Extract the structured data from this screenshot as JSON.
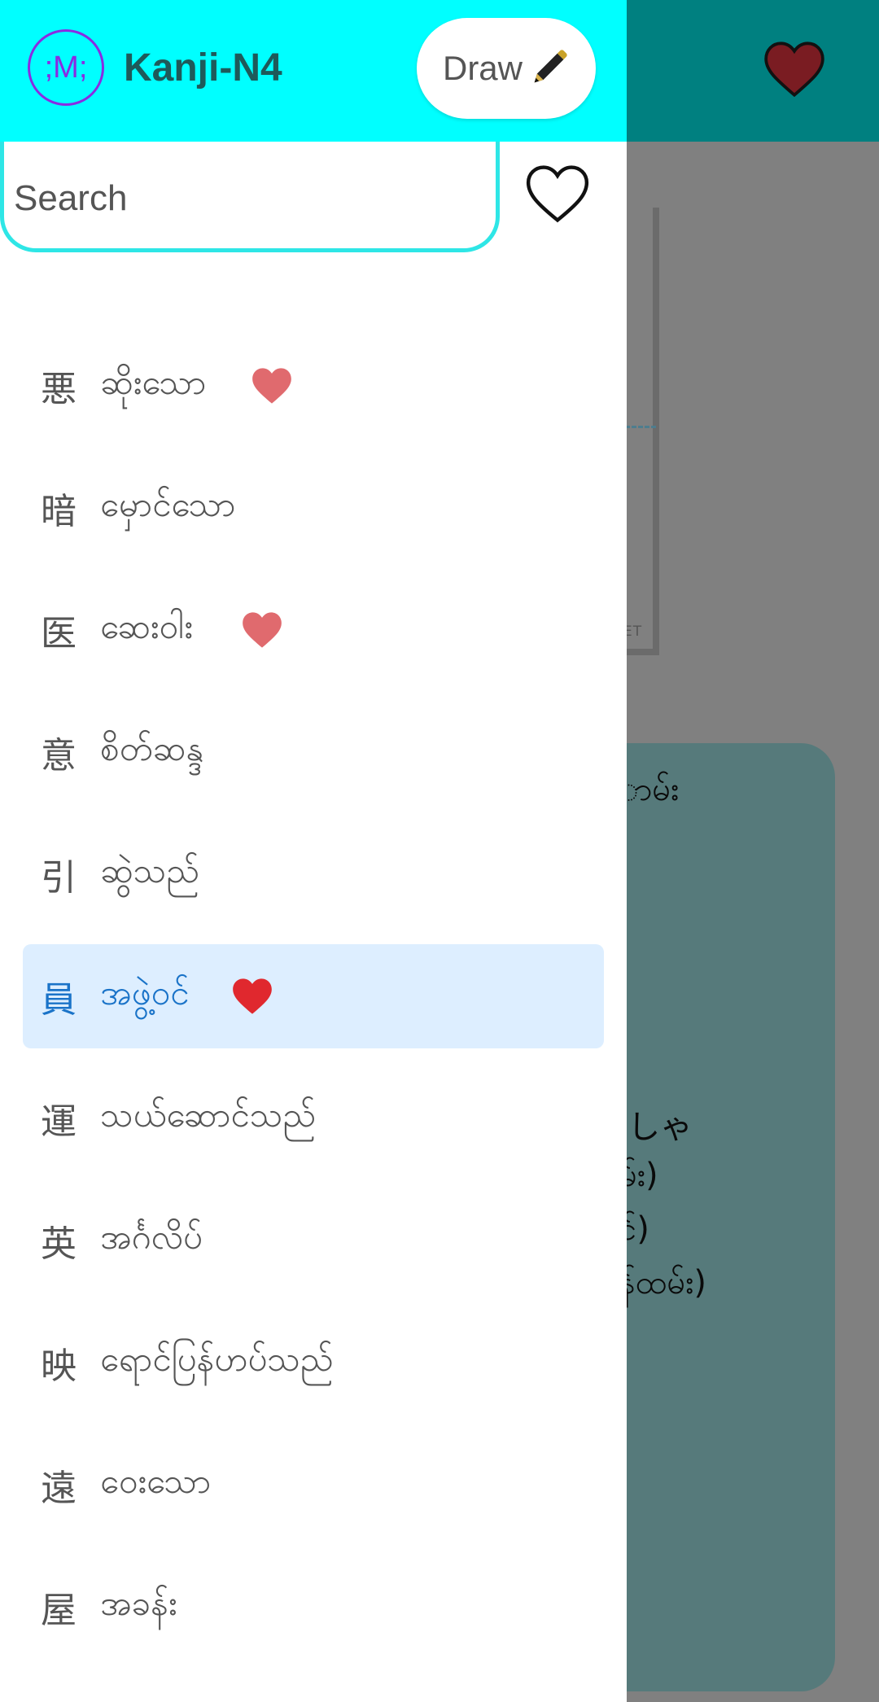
{
  "app": {
    "logo_text": ";M;",
    "title": "Kanji-N4"
  },
  "header": {
    "draw_label": "Draw"
  },
  "search": {
    "placeholder": "Search",
    "value": ""
  },
  "background": {
    "frame_text": "ET",
    "card_lines": [
      "ာမ်း",
      "ıしゃ",
      "မ်း)",
      "င်)",
      "န်ထမ်း)"
    ]
  },
  "colors": {
    "header": "#00ffff",
    "background_appbar": "#008080",
    "selected_row": "#ddeeff",
    "selected_text": "#1a73c8",
    "heart_red": "#e0282e",
    "heart_faded": "#e06a6e"
  },
  "kanji_list": [
    {
      "kanji": "悪",
      "meaning": "ဆိုးသော",
      "favorite": true,
      "selected": false
    },
    {
      "kanji": "暗",
      "meaning": "မှောင်သော",
      "favorite": false,
      "selected": false
    },
    {
      "kanji": "医",
      "meaning": "ဆေးဝါး",
      "favorite": true,
      "selected": false
    },
    {
      "kanji": "意",
      "meaning": "စိတ်ဆန္ဒ",
      "favorite": false,
      "selected": false
    },
    {
      "kanji": "引",
      "meaning": "ဆွဲသည်",
      "favorite": false,
      "selected": false
    },
    {
      "kanji": "員",
      "meaning": "အဖွဲ့ဝင်",
      "favorite": true,
      "selected": true
    },
    {
      "kanji": "運",
      "meaning": "သယ်ဆောင်သည်",
      "favorite": false,
      "selected": false
    },
    {
      "kanji": "英",
      "meaning": "အင်္ဂလိပ်",
      "favorite": false,
      "selected": false
    },
    {
      "kanji": "映",
      "meaning": "ရောင်ပြန်ဟပ်သည်",
      "favorite": false,
      "selected": false
    },
    {
      "kanji": "遠",
      "meaning": "ဝေးသော",
      "favorite": false,
      "selected": false
    },
    {
      "kanji": "屋",
      "meaning": "အခန်း",
      "favorite": false,
      "selected": false
    }
  ]
}
